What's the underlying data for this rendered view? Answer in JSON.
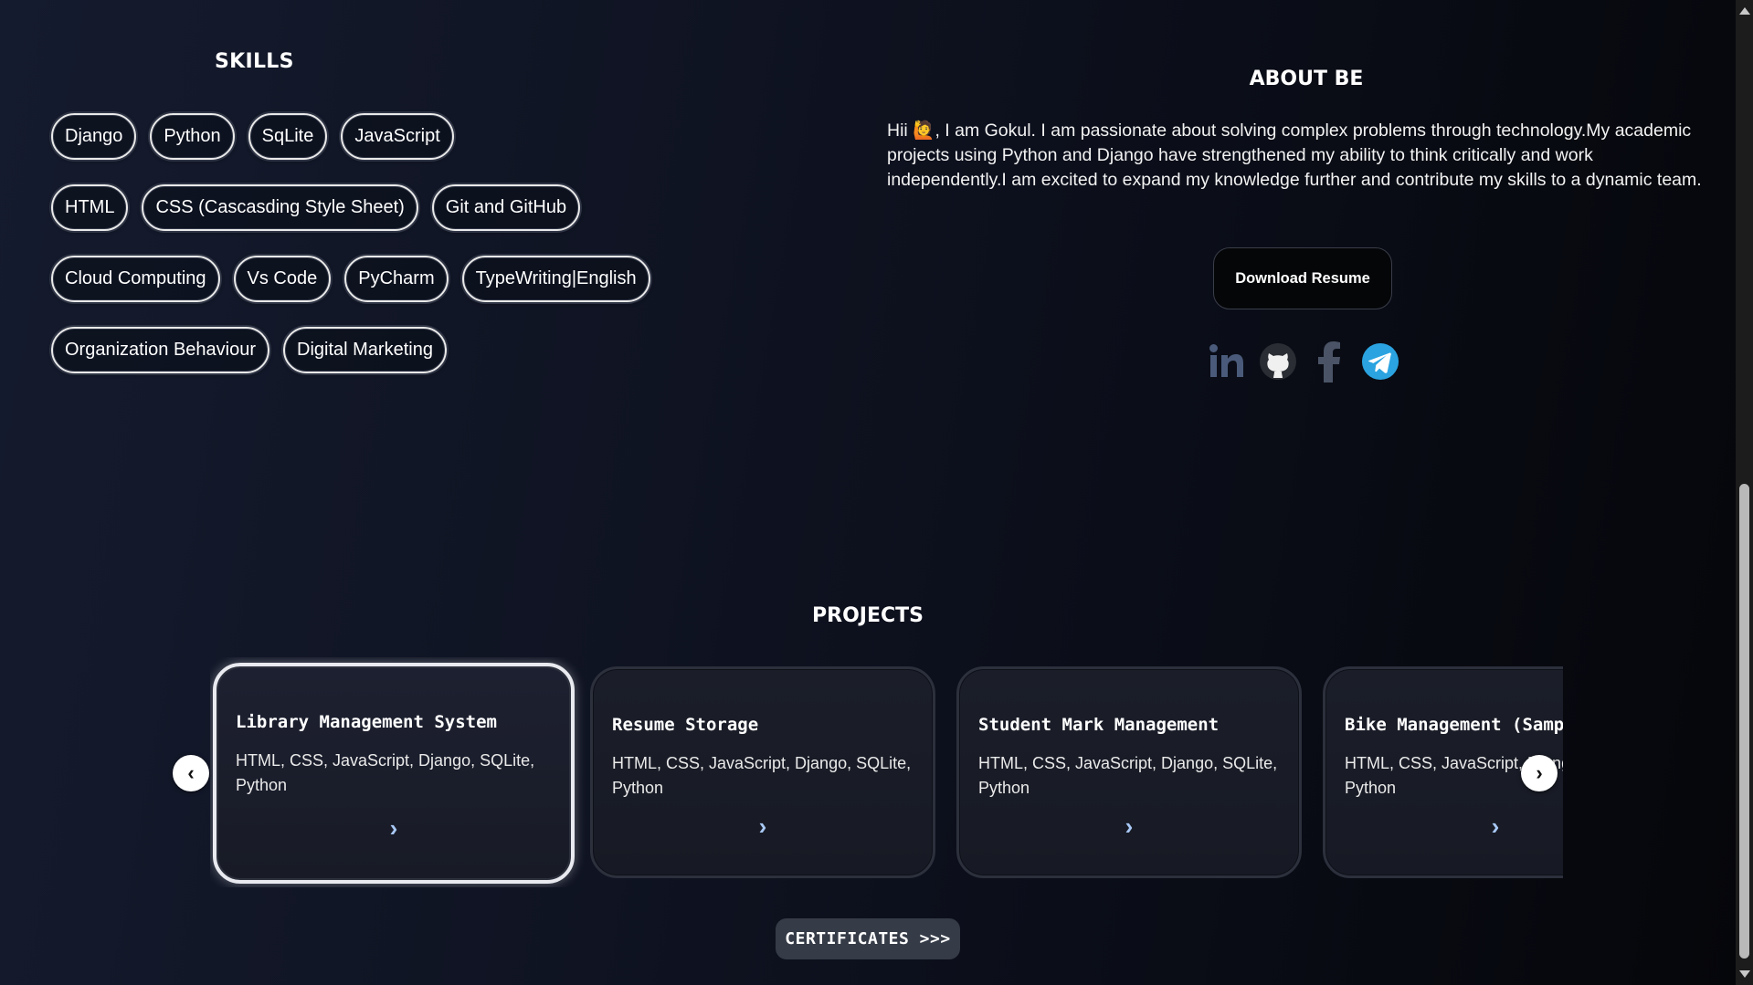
{
  "skills": {
    "title": "SKILLS",
    "rows": [
      [
        "Django",
        "Python",
        "SqLite",
        "JavaScript"
      ],
      [
        "HTML",
        "CSS (Cascasding Style Sheet)",
        "Git and GitHub"
      ],
      [
        "Cloud Computing",
        "Vs Code",
        "PyCharm",
        "TypeWriting|English"
      ],
      [
        "Organization Behaviour",
        "Digital Marketing"
      ]
    ]
  },
  "about": {
    "title": "ABOUT BE",
    "text": "Hii 🙋, I am Gokul. I am passionate about solving complex problems through technology.My academic projects using Python and Django have strengthened my ability to think critically and work independently.I am excited to expand my knowledge further and contribute my skills to a dynamic team.",
    "download_label": "Download Resume",
    "socials": [
      "linkedin-icon",
      "github-icon",
      "facebook-icon",
      "telegram-icon"
    ]
  },
  "projects": {
    "title": "PROJECTS",
    "cards": [
      {
        "title": "Library Management System",
        "tech": "HTML, CSS, JavaScript, Django, SQLite, Python",
        "arrow": "›"
      },
      {
        "title": "Resume Storage",
        "tech": "HTML, CSS, JavaScript, Django, SQLite, Python",
        "arrow": "›"
      },
      {
        "title": "Student Mark Management",
        "tech": "HTML, CSS, JavaScript, Django, SQLite, Python",
        "arrow": "›"
      },
      {
        "title": "Bike Management (Sample)",
        "tech": "HTML, CSS, JavaScript, Django, SQLite, Python",
        "arrow": "›"
      }
    ],
    "prev_label": "‹",
    "next_label": "›"
  },
  "certificates_label": "CERTIFICATES >>>",
  "colors": {
    "accent_arrow": "#a8c8f5",
    "chip_border": "#e9e9e9",
    "button_bg": "#353b47"
  }
}
